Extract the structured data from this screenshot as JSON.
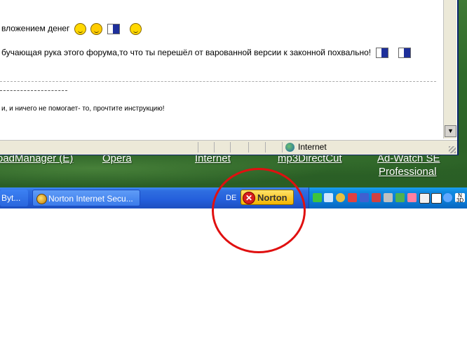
{
  "browser": {
    "content_lines": [
      "вложением денег",
      "бучающая рука этого форума,то что ты перешёл от варованной версии к законной похвально!",
      "и, и ничего не помогает- то, прочтите инструкцию!"
    ],
    "status_zone": "Internet"
  },
  "desktop": {
    "icons": [
      {
        "label": "oadManager (E)"
      },
      {
        "label": "Opera"
      },
      {
        "label": "Internet"
      },
      {
        "label": "mp3DirectCut"
      },
      {
        "label": "Ad-Watch SE"
      },
      {
        "label": "Professional"
      }
    ]
  },
  "taskbar": {
    "buttons": [
      {
        "label": "Byt..."
      },
      {
        "label": "Norton Internet Secu..."
      }
    ],
    "language": "DE",
    "norton_label": "Norton",
    "tray_icon_names": [
      "network-icon",
      "display-icon",
      "globe-icon",
      "media-icon",
      "mail-icon",
      "security-icon",
      "speaker-icon",
      "clock-icon",
      "shield-icon",
      "app-icon",
      "refresh-icon",
      "search-icon",
      "ntn-icon"
    ],
    "tray_text": "N 3D"
  },
  "colors": {
    "annotation": "#e01010",
    "taskbar": "#245edb",
    "norton_badge": "#f4b400"
  }
}
